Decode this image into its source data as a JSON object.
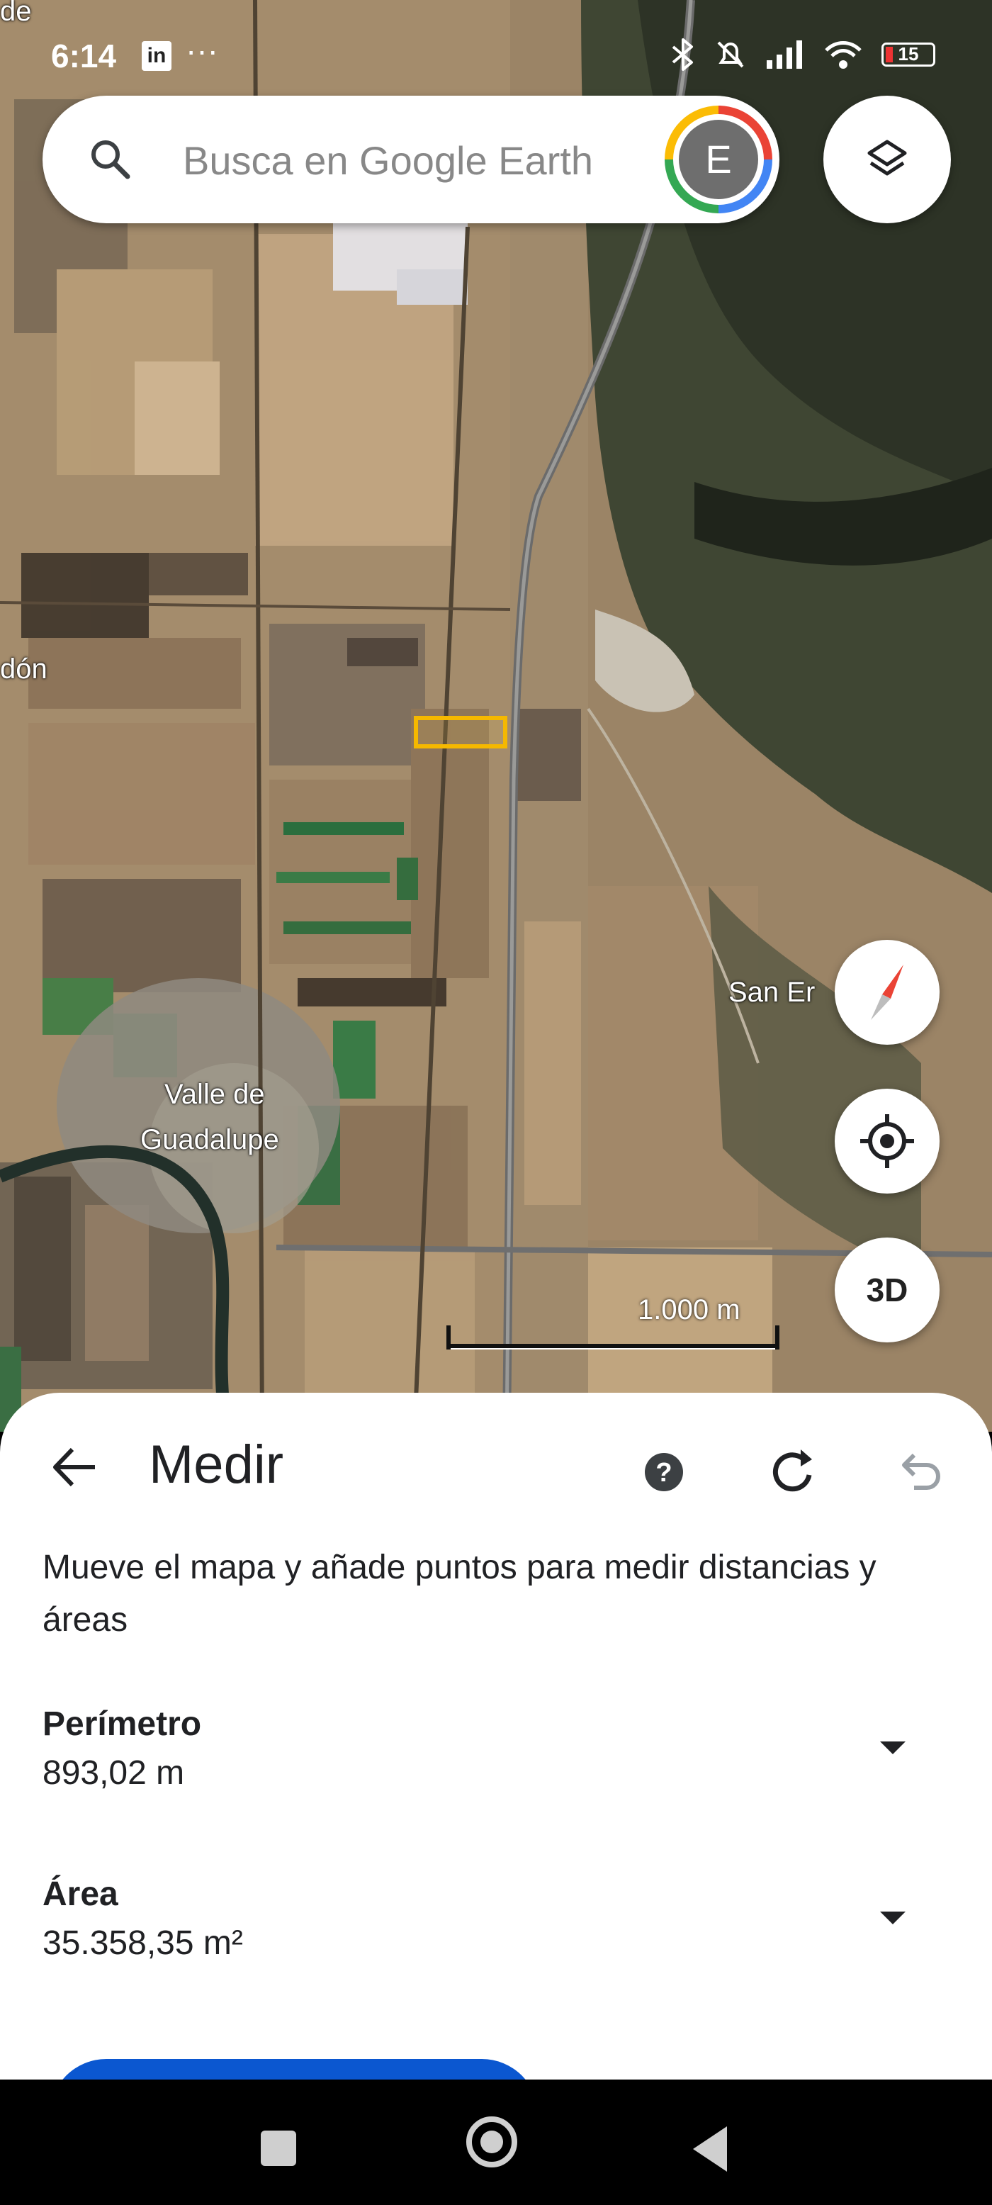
{
  "status_bar": {
    "time": "6:14",
    "linkedin": "in",
    "overflow": "···",
    "battery": "15"
  },
  "search": {
    "placeholder": "Busca en Google Earth",
    "avatar_letter": "E"
  },
  "map": {
    "labels": {
      "top_left_partial": "de",
      "left_partial": "dón",
      "town_line1": "Valle de",
      "town_line2": "Guadalupe",
      "east_partial": "San Er"
    },
    "scale_label": "1.000 m",
    "button_3d": "3D",
    "icons": [
      "search-icon",
      "layers-icon",
      "compass-icon",
      "my-location-icon"
    ]
  },
  "measure_panel": {
    "title": "Medir",
    "help": "?",
    "description": "Mueve el mapa y añade puntos para medir distancias y áreas",
    "perimeter_label": "Perímetro",
    "perimeter_value": "893,02 m",
    "area_label": "Área",
    "area_value": "35.358,35 m²",
    "icons": [
      "back-arrow-icon",
      "help-icon",
      "refresh-icon",
      "undo-icon",
      "chevron-down-icon"
    ]
  },
  "colors": {
    "primary_button": "#0b57d0",
    "measured_polygon": "#f5b800"
  }
}
